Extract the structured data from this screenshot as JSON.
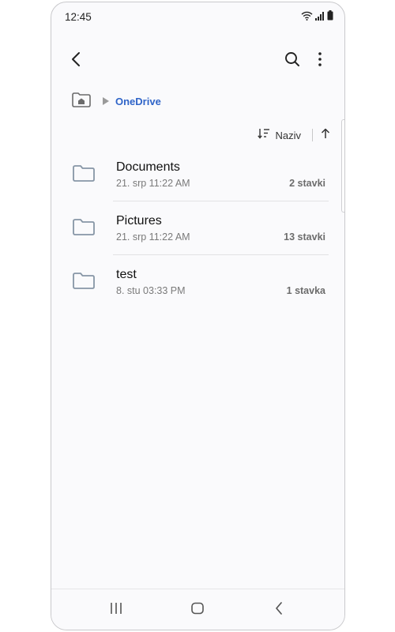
{
  "status_bar": {
    "time": "12:45",
    "icons": [
      "wifi-icon",
      "signal-icon",
      "battery-icon"
    ]
  },
  "app_bar": {
    "back_icon": "chevron-left-icon",
    "search_icon": "search-icon",
    "more_icon": "more-vertical-icon"
  },
  "breadcrumb": {
    "home_icon": "home-folder-icon",
    "current": "OneDrive"
  },
  "sort": {
    "label": "Naziv",
    "sort_icon": "sort-icon",
    "direction_icon": "arrow-up-icon"
  },
  "files": [
    {
      "name": "Documents",
      "date": "21. srp 11:22 AM",
      "count": "2 stavki"
    },
    {
      "name": "Pictures",
      "date": "21. srp 11:22 AM",
      "count": "13 stavki"
    },
    {
      "name": "test",
      "date": "8. stu 03:33 PM",
      "count": "1 stavka"
    }
  ],
  "nav_bar": {
    "recent_icon": "recent-apps-icon",
    "home_icon": "home-icon",
    "back_icon": "back-icon"
  },
  "colors": {
    "accent": "#2f64c8",
    "background": "#fafafc",
    "folder": "#8796a6"
  }
}
